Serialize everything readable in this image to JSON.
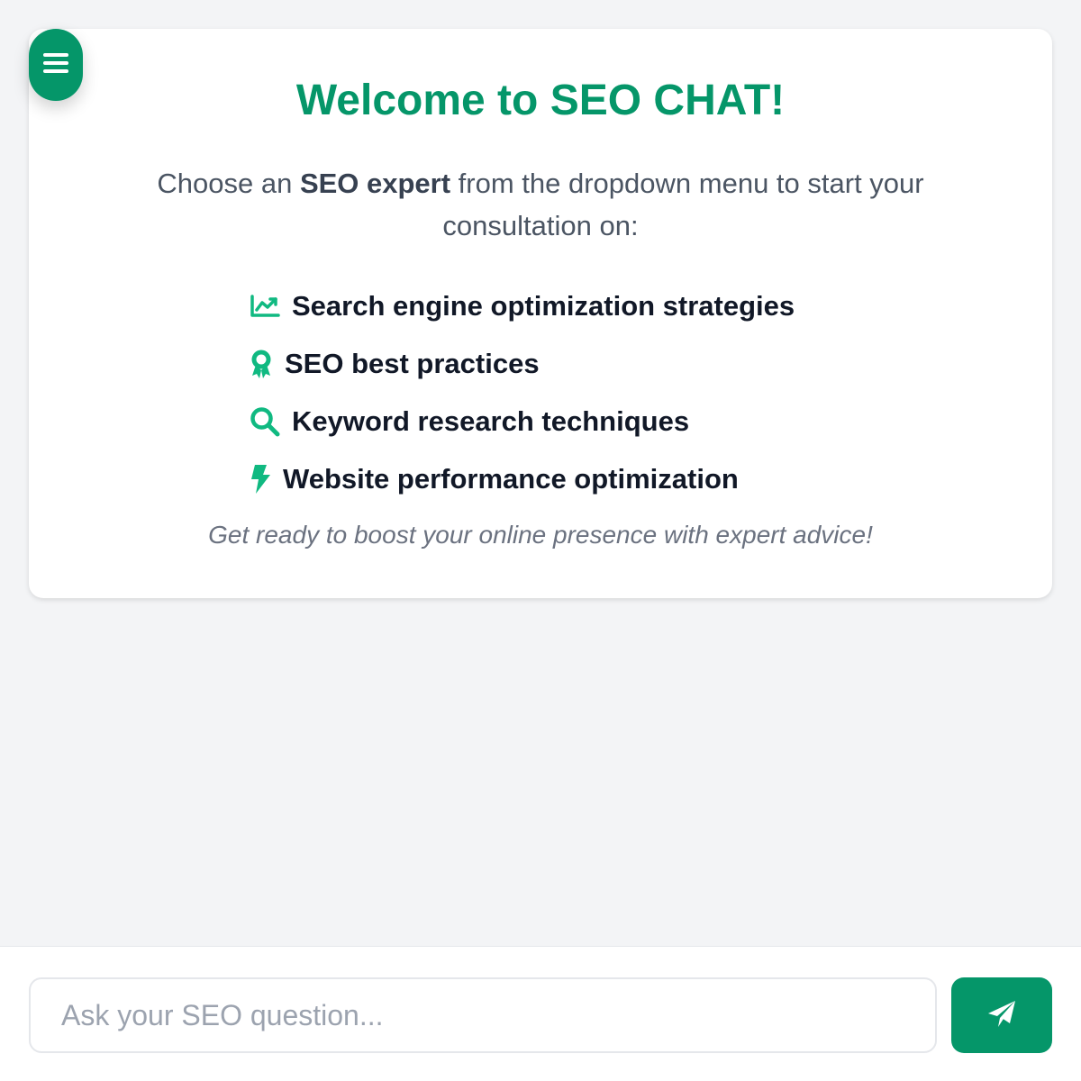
{
  "menu_button": {
    "icon": "hamburger-menu-icon"
  },
  "welcome": {
    "title": "Welcome to SEO CHAT!",
    "intro_before": "Choose an ",
    "intro_bold": "SEO expert",
    "intro_after": " from the dropdown menu to start your consultation on:",
    "features": [
      {
        "icon": "trending-chart-icon",
        "label": "Search engine optimization strategies"
      },
      {
        "icon": "award-ribbon-icon",
        "label": "SEO best practices"
      },
      {
        "icon": "search-icon",
        "label": "Keyword research techniques"
      },
      {
        "icon": "lightning-bolt-icon",
        "label": "Website performance optimization"
      }
    ],
    "tagline": "Get ready to boost your online presence with expert advice!"
  },
  "composer": {
    "placeholder": "Ask your SEO question...",
    "value": "",
    "send_icon": "paper-plane-icon"
  },
  "colors": {
    "accent": "#059669",
    "icon_accent": "#10b981",
    "background": "#f3f4f6"
  }
}
